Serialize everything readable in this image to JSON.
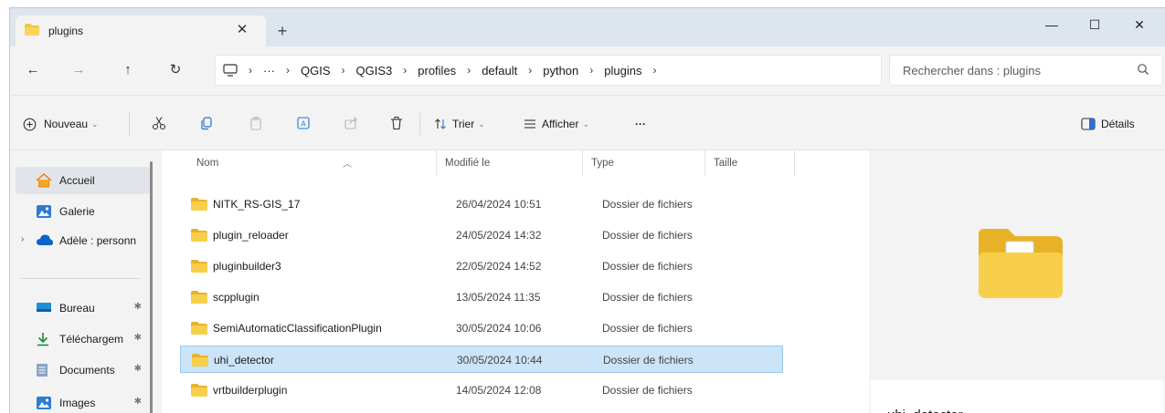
{
  "window": {
    "tab_title": "plugins",
    "tab_close": "✕",
    "tab_add": "+",
    "minimize": "—",
    "maximize": "☐",
    "close": "✕"
  },
  "nav": {
    "back": "←",
    "forward": "→",
    "up": "↑",
    "refresh": "↻"
  },
  "address": {
    "more": "···",
    "sep": "›",
    "crumbs": [
      "QGIS",
      "QGIS3",
      "profiles",
      "default",
      "python",
      "plugins"
    ]
  },
  "search": {
    "placeholder": "Rechercher dans : plugins"
  },
  "toolbar": {
    "new_label": "Nouveau",
    "sort_label": "Trier",
    "view_label": "Afficher",
    "more_label": "···",
    "details_label": "Détails"
  },
  "sidebar": {
    "items": [
      {
        "label": "Accueil",
        "icon": "home-icon"
      },
      {
        "label": "Galerie",
        "icon": "gallery-icon"
      },
      {
        "label": "Adèle : personn",
        "icon": "cloud-icon"
      },
      {
        "label": "Bureau",
        "icon": "desktop-icon"
      },
      {
        "label": "Téléchargem",
        "icon": "download-icon"
      },
      {
        "label": "Documents",
        "icon": "documents-icon"
      },
      {
        "label": "Images",
        "icon": "images-icon"
      }
    ],
    "pin": "✱"
  },
  "columns": {
    "name": "Nom",
    "modified": "Modifié le",
    "type": "Type",
    "size": "Taille"
  },
  "files": [
    {
      "name": "NITK_RS-GIS_17",
      "modified": "26/04/2024 10:51",
      "type": "Dossier de fichiers"
    },
    {
      "name": "plugin_reloader",
      "modified": "24/05/2024 14:32",
      "type": "Dossier de fichiers"
    },
    {
      "name": "pluginbuilder3",
      "modified": "22/05/2024 14:52",
      "type": "Dossier de fichiers"
    },
    {
      "name": "scpplugin",
      "modified": "13/05/2024 11:35",
      "type": "Dossier de fichiers"
    },
    {
      "name": "SemiAutomaticClassificationPlugin",
      "modified": "30/05/2024 10:06",
      "type": "Dossier de fichiers"
    },
    {
      "name": "uhi_detector",
      "modified": "30/05/2024 10:44",
      "type": "Dossier de fichiers",
      "selected": true
    },
    {
      "name": "vrtbuilderplugin",
      "modified": "14/05/2024 12:08",
      "type": "Dossier de fichiers"
    }
  ],
  "details": {
    "selected_name": "uhi_detector"
  },
  "colors": {
    "folder": "#f4c542",
    "selection": "#cce4f7",
    "accent": "#0067c0"
  }
}
